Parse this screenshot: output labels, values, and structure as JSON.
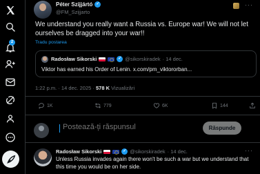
{
  "nav": {
    "items": [
      {
        "name": "x-logo-icon"
      },
      {
        "name": "home-icon"
      },
      {
        "name": "search-icon"
      },
      {
        "name": "notifications-icon",
        "badge": "2"
      },
      {
        "name": "follow-icon"
      },
      {
        "name": "messages-icon"
      },
      {
        "name": "grok-icon"
      },
      {
        "name": "communities-icon"
      },
      {
        "name": "profile-icon"
      },
      {
        "name": "more-icon"
      }
    ],
    "post_button_icon": "feather-icon"
  },
  "post": {
    "author_name": "Péter Szijjártó",
    "handle": "@FM_Szijjarto",
    "text": "We understand you really want a Russia vs. Europe war! We will not let ourselves be dragged into your war!!",
    "translate_label": "Tradu postarea",
    "more": "···",
    "timestamp": "1:22 p.m. · 14 dec. 2025 ·",
    "views_count": "578 K",
    "views_label": "Vizualizări"
  },
  "quote": {
    "author_name": "Radosław Sikorski",
    "handle": "@sikorskiradek",
    "date": "· 14 dec.",
    "text": "Viktor has earned his Order of Lenin. x.com/pm_viktororban..."
  },
  "actions": {
    "replies": "1K",
    "reposts": "779",
    "likes": "6K",
    "bookmarks": "144"
  },
  "reply_box": {
    "placeholder": "Postează-ți răspunsul",
    "button_label": "Răspunde"
  },
  "reply": {
    "author_name": "Radosław Sikorski",
    "handle": "@sikorskiradek",
    "date": "· 14 dec.",
    "text": "Unless Russia invades again there won't be such a war but we understand that this time you would be on her side.",
    "more": "···"
  },
  "colors": {
    "background": "#000000",
    "text": "#e7e9ea",
    "muted": "#71767b",
    "accent": "#1d9bf0",
    "border": "#2f3336"
  }
}
